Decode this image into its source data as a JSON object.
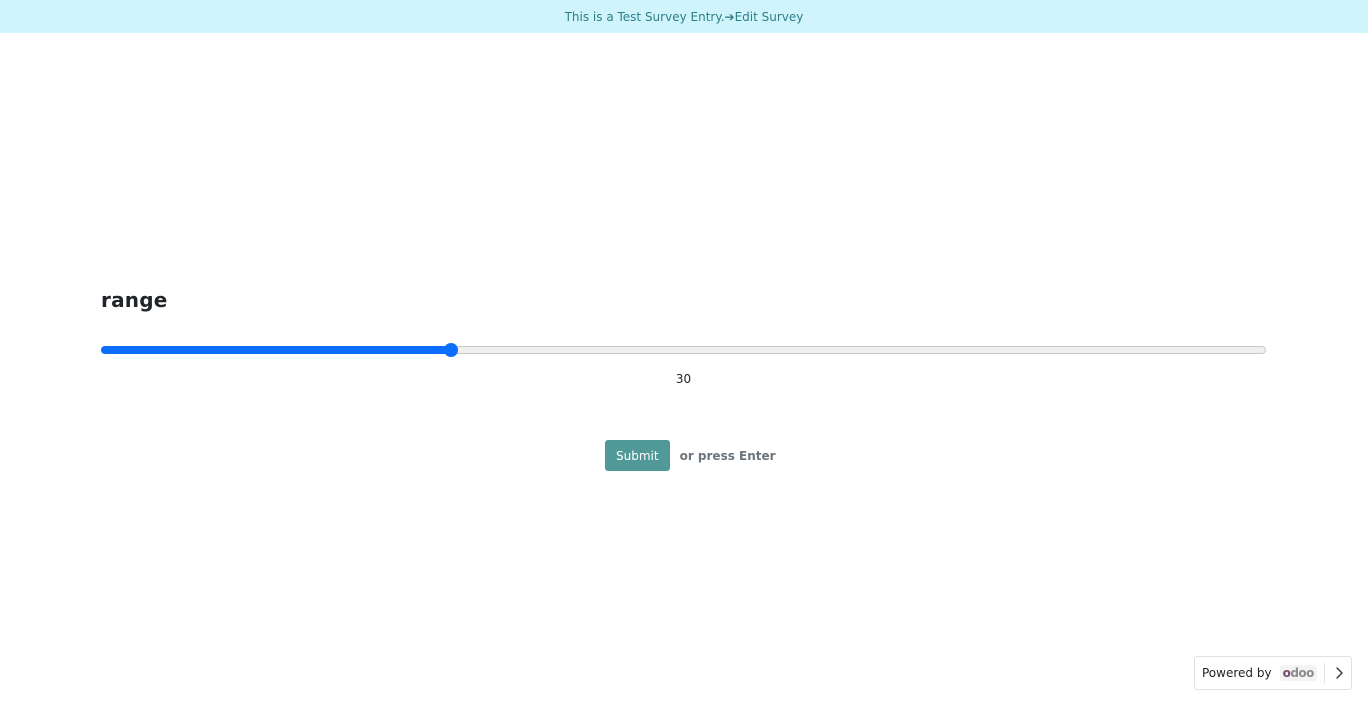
{
  "banner": {
    "text": "This is a Test Survey Entry.",
    "edit_link": "➔Edit Survey"
  },
  "question": {
    "title": "range",
    "value": "30",
    "range_fraction": 0.3
  },
  "actions": {
    "submit_label": "Submit",
    "hint": "or press Enter"
  },
  "footer": {
    "powered_by": "Powered by",
    "logo_text": "odoo"
  },
  "colors": {
    "banner_bg": "#cff4fc",
    "accent": "#0d6efd",
    "submit_bg": "#519899"
  }
}
